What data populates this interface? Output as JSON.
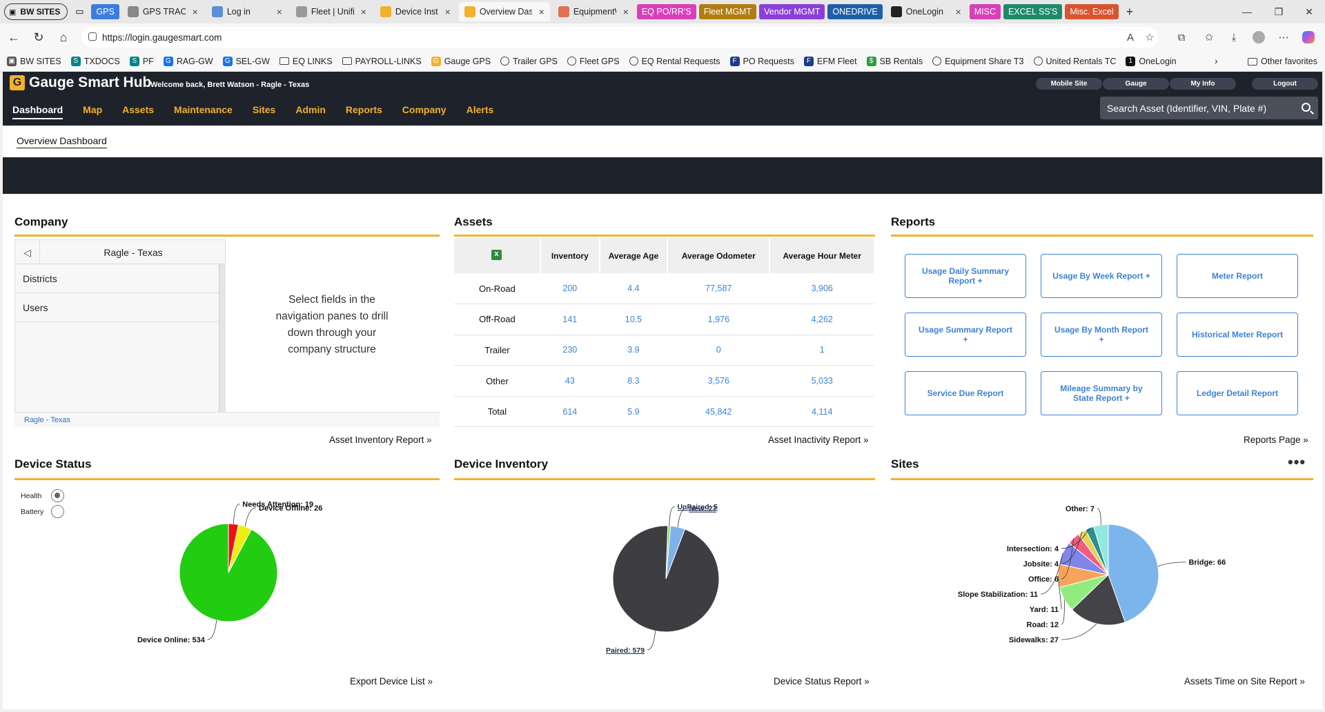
{
  "browser": {
    "tab_group_label": "BW SITES",
    "tabs": [
      {
        "label": "GPS",
        "kind": "group",
        "color": "#3b7ddd"
      },
      {
        "label": "GPS TRACKIN",
        "kind": "tab",
        "icon": "globe-icon"
      },
      {
        "label": "Log in",
        "kind": "tab",
        "icon": "my-icon"
      },
      {
        "label": "Fleet | Unified",
        "kind": "tab",
        "icon": "fleet-icon"
      },
      {
        "label": "Device Install",
        "kind": "tab",
        "icon": "gauge-icon"
      },
      {
        "label": "Overview Das",
        "kind": "tab",
        "icon": "gauge-icon",
        "active": true
      },
      {
        "label": "EquipmentW",
        "kind": "tab",
        "icon": "equip-icon"
      },
      {
        "label": "EQ PO/RR'S",
        "kind": "group",
        "color": "#d93fb8"
      },
      {
        "label": "Fleet MGMT",
        "kind": "group",
        "color": "#b07d12"
      },
      {
        "label": "Vendor MGMT",
        "kind": "group",
        "color": "#8b3fd9"
      },
      {
        "label": "ONEDRIVE",
        "kind": "group",
        "color": "#1f5fa8"
      },
      {
        "label": "OneLogin",
        "kind": "tab",
        "icon": "onelogin-icon"
      },
      {
        "label": "MISC",
        "kind": "group",
        "color": "#d93fb8"
      },
      {
        "label": "EXCEL SS'S",
        "kind": "group",
        "color": "#1f8a6a"
      },
      {
        "label": "Misc. Excel",
        "kind": "group",
        "color": "#d9532f"
      }
    ],
    "url": "https://login.gaugesmart.com",
    "favorites": [
      {
        "label": "BW SITES",
        "icon": "tab-group-icon"
      },
      {
        "label": "TXDOCS",
        "icon": "sharepoint-icon"
      },
      {
        "label": "PF",
        "icon": "sharepoint-icon"
      },
      {
        "label": "RAG-GW",
        "icon": "g-icon"
      },
      {
        "label": "SEL-GW",
        "icon": "g-icon"
      },
      {
        "label": "EQ LINKS",
        "icon": "folder-icon"
      },
      {
        "label": "PAYROLL-LINKS",
        "icon": "folder-icon"
      },
      {
        "label": "Gauge GPS",
        "icon": "gauge-icon"
      },
      {
        "label": "Trailer GPS",
        "icon": "globe-icon"
      },
      {
        "label": "Fleet GPS",
        "icon": "globe-icon"
      },
      {
        "label": "EQ Rental Requests",
        "icon": "globe-icon"
      },
      {
        "label": "PO Requests",
        "icon": "form-icon"
      },
      {
        "label": "EFM Fleet",
        "icon": "form-icon"
      },
      {
        "label": "SB Rentals",
        "icon": "sb-icon"
      },
      {
        "label": "Equipment Share T3",
        "icon": "globe-icon"
      },
      {
        "label": "United Rentals TC",
        "icon": "globe-icon"
      },
      {
        "label": "OneLogin",
        "icon": "onelogin-icon"
      }
    ],
    "other_favorites": "Other favorites"
  },
  "app": {
    "title": "Gauge Smart Hub",
    "welcome": "Welcome back, Brett Watson - Ragle - Texas",
    "header_buttons": [
      "Mobile Site",
      "Gauge",
      "My Info",
      "Logout"
    ],
    "nav": [
      "Dashboard",
      "Map",
      "Assets",
      "Maintenance",
      "Sites",
      "Admin",
      "Reports",
      "Company",
      "Alerts"
    ],
    "search_placeholder": "Search Asset (Identifier, VIN, Plate #)",
    "subnav_tab": "Overview Dashboard",
    "accent": "#f2b12d"
  },
  "company": {
    "title": "Company",
    "selected": "Ragle - Texas",
    "items": [
      "Districts",
      "Users"
    ],
    "hint": "Select fields in the navigation panes to drill down through your company structure",
    "breadcrumb": "Ragle - Texas",
    "link": "Asset Inventory Report »"
  },
  "assets": {
    "title": "Assets",
    "columns": [
      "",
      "Inventory",
      "Average Age",
      "Average Odometer",
      "Average Hour Meter"
    ],
    "rows": [
      [
        "On-Road",
        "200",
        "4.4",
        "77,587",
        "3,906"
      ],
      [
        "Off-Road",
        "141",
        "10.5",
        "1,976",
        "4,262"
      ],
      [
        "Trailer",
        "230",
        "3.9",
        "0",
        "1"
      ],
      [
        "Other",
        "43",
        "8.3",
        "3,576",
        "5,033"
      ],
      [
        "Total",
        "614",
        "5.9",
        "45,842",
        "4,114"
      ]
    ],
    "link": "Asset Inactivity Report »"
  },
  "reports": {
    "title": "Reports",
    "buttons": [
      "Usage Daily Summary Report +",
      "Usage By Week Report +",
      "Meter Report",
      "Usage Summary Report +",
      "Usage By Month Report +",
      "Historical Meter Report",
      "Service Due Report",
      "Mileage Summary by State Report +",
      "Ledger Detail Report"
    ],
    "link": "Reports Page »"
  },
  "device_status": {
    "title": "Device Status",
    "radios": [
      "Health",
      "Battery"
    ],
    "selected_radio": "Health",
    "link": "Export Device List »"
  },
  "device_inventory": {
    "title": "Device Inventory",
    "link": "Device Status Report »"
  },
  "sites": {
    "title": "Sites",
    "link": "Assets Time on Site Report »"
  },
  "chart_data": [
    {
      "type": "pie",
      "id": "device-status",
      "categories": [
        "Device Online",
        "Needs Attention",
        "Device Offline"
      ],
      "values": [
        534,
        19,
        26
      ],
      "labels": [
        "Device Online: 534",
        "Needs Attention: 19",
        "Device Offline: 26"
      ],
      "colors": [
        "#22cc11",
        "#ee1111",
        "#eeee11"
      ]
    },
    {
      "type": "pie",
      "id": "device-inventory",
      "categories": [
        "Paired",
        "UnPaired",
        "New"
      ],
      "values": [
        579,
        5,
        27
      ],
      "labels": [
        "Paired: 579",
        "UnPaired: 5",
        "New: 27"
      ],
      "colors": [
        "#3e3e42",
        "#8fd97a",
        "#7db3ea"
      ]
    },
    {
      "type": "pie",
      "id": "sites",
      "categories": [
        "Bridge",
        "Sidewalks",
        "Road",
        "Yard",
        "Slope Stabilization",
        "Office",
        "Jobsite",
        "Intersection",
        "Other"
      ],
      "values": [
        66,
        27,
        12,
        11,
        11,
        6,
        4,
        4,
        7
      ],
      "labels": [
        "Bridge: 66",
        "Sidewalks: 27",
        "Road: 12",
        "Yard: 11",
        "Slope Stabilization: 11",
        "Office: 6",
        "Jobsite: 4",
        "Intersection: 4",
        "Other: 7"
      ],
      "colors": [
        "#7cb5ec",
        "#434348",
        "#90ed7d",
        "#f7a35c",
        "#8085e9",
        "#f15c80",
        "#e4d354",
        "#2b908f",
        "#91e8e1"
      ]
    }
  ]
}
